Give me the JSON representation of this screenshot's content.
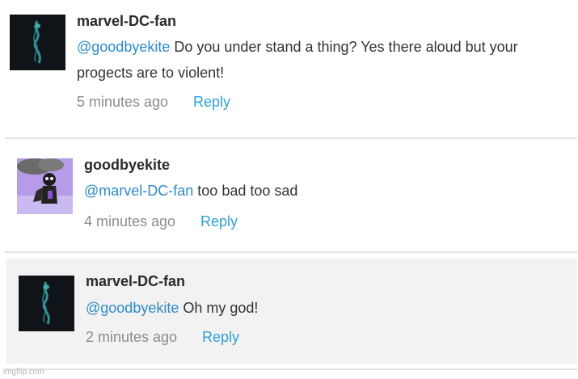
{
  "comments": [
    {
      "username": "marvel-DC-fan",
      "mention": "@goodbyekite",
      "text": " Do you under stand a thing? Yes there aloud but your progects are to violent!",
      "time": "5 minutes ago",
      "reply_label": "Reply",
      "avatar_icon": "dark-smoke-avatar"
    },
    {
      "username": "goodbyekite",
      "mention": "@marvel-DC-fan",
      "text": " too bad too sad",
      "time": "4 minutes ago",
      "reply_label": "Reply",
      "avatar_icon": "purple-character-avatar"
    },
    {
      "username": "marvel-DC-fan",
      "mention": "@goodbyekite",
      "text": " Oh my god!",
      "time": "2 minutes ago",
      "reply_label": "Reply",
      "avatar_icon": "dark-smoke-avatar"
    }
  ],
  "watermark": "imgflip.com",
  "colors": {
    "mention": "#2f8bc9",
    "reply": "#2fa0d8",
    "timestamp": "#8c8c8c",
    "highlight_bg": "#f2f2f2"
  }
}
